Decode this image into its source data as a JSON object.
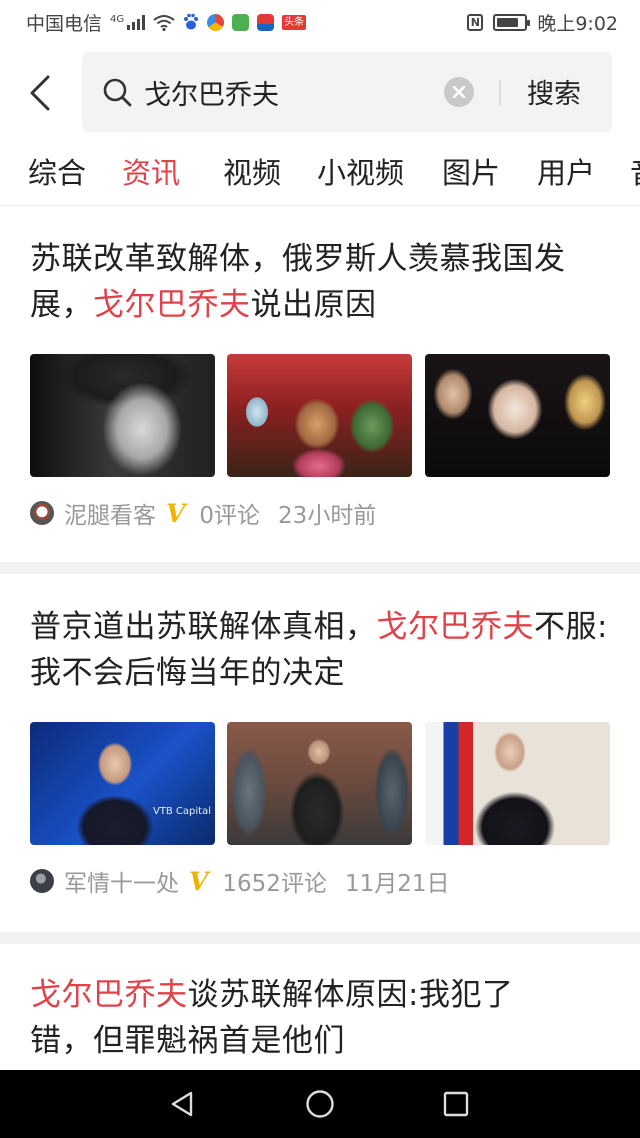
{
  "status": {
    "carrier": "中国电信",
    "network": "4G",
    "news_badge": "头条",
    "time": "晚上9:02",
    "battery_percent": 80
  },
  "search": {
    "query": "戈尔巴乔夫",
    "search_label": "搜索"
  },
  "tabs": [
    "综合",
    "资讯",
    "视频",
    "小视频",
    "图片",
    "用户",
    "音"
  ],
  "active_tab_index": 1,
  "articles": [
    {
      "title_pre": "苏联改革致解体，俄罗斯人羡慕我国发展，",
      "title_hl": "戈尔巴乔夫",
      "title_post": "说出原因",
      "author": "泥腿看客",
      "verified_mark": "V",
      "comments": "0评论",
      "time": "23小时前"
    },
    {
      "title_pre": "普京道出苏联解体真相，",
      "title_hl": "戈尔巴乔夫",
      "title_post": "不服:我不会后悔当年的决定",
      "author": "军情十一处",
      "verified_mark": "V",
      "comments": "1652评论",
      "time": "11月21日",
      "photo_logo": "VTB Capital"
    },
    {
      "title_hl": "戈尔巴乔夫",
      "title_post": "谈苏联解体原因:我犯了错，但罪魁祸首是他们"
    }
  ],
  "colors": {
    "accent": "#e0424a",
    "verified": "#f0b400",
    "meta": "#999999"
  },
  "icons": [
    "back-arrow-icon",
    "search-icon",
    "clear-icon",
    "nav-back-icon",
    "nav-home-icon",
    "nav-recents-icon"
  ]
}
